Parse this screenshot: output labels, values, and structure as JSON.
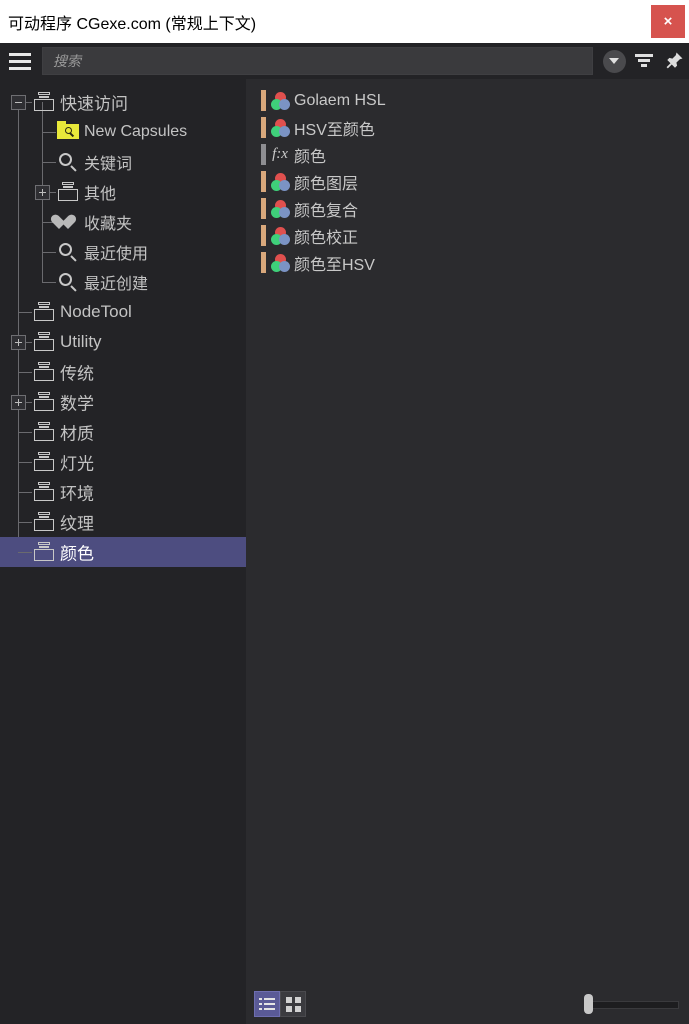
{
  "window": {
    "title": "可动程序 CGexe.com (常规上下文)",
    "close_label": "×",
    "close_icon": "close-icon",
    "close_color": "#d6534e"
  },
  "toolbar": {
    "menu_icon": "hamburger-menu-icon",
    "search_placeholder": "搜索",
    "search_value": "",
    "dropdown_icon": "chevron-down-icon",
    "filter_icon": "filter-icon",
    "pin_icon": "pin-icon"
  },
  "tree": {
    "items": [
      {
        "label": "快速访问",
        "icon": "capsule-icon",
        "indent": 0,
        "toggle": "minus",
        "selected": false
      },
      {
        "label": "New Capsules",
        "icon": "folder-icon",
        "indent": 1,
        "toggle": "none",
        "selected": false
      },
      {
        "label": "关键词",
        "icon": "magnifier-icon",
        "indent": 1,
        "toggle": "none",
        "selected": false
      },
      {
        "label": "其他",
        "icon": "capsule-icon",
        "indent": 1,
        "toggle": "plus",
        "selected": false
      },
      {
        "label": "收藏夹",
        "icon": "heart-icon",
        "indent": 1,
        "toggle": "none",
        "selected": false
      },
      {
        "label": "最近使用",
        "icon": "magnifier-icon",
        "indent": 1,
        "toggle": "none",
        "selected": false
      },
      {
        "label": "最近创建",
        "icon": "magnifier-icon",
        "indent": 1,
        "toggle": "none",
        "selected": false
      },
      {
        "label": "NodeTool",
        "icon": "capsule-icon",
        "indent": 0,
        "toggle": "none",
        "selected": false
      },
      {
        "label": "Utility",
        "icon": "capsule-icon",
        "indent": 0,
        "toggle": "plus",
        "selected": false
      },
      {
        "label": "传统",
        "icon": "capsule-icon",
        "indent": 0,
        "toggle": "none",
        "selected": false
      },
      {
        "label": "数学",
        "icon": "capsule-icon",
        "indent": 0,
        "toggle": "plus",
        "selected": false
      },
      {
        "label": "材质",
        "icon": "capsule-icon",
        "indent": 0,
        "toggle": "none",
        "selected": false
      },
      {
        "label": "灯光",
        "icon": "capsule-icon",
        "indent": 0,
        "toggle": "none",
        "selected": false
      },
      {
        "label": "环境",
        "icon": "capsule-icon",
        "indent": 0,
        "toggle": "none",
        "selected": false
      },
      {
        "label": "纹理",
        "icon": "capsule-icon",
        "indent": 0,
        "toggle": "none",
        "selected": false
      },
      {
        "label": "颜色",
        "icon": "capsule-icon",
        "indent": 0,
        "toggle": "none",
        "selected": true
      }
    ],
    "selected_color": "#4d4d80"
  },
  "list": {
    "items": [
      {
        "label": "Golaem HSL",
        "icon": "rgb-circles-icon",
        "bar_color": "#d9a87c"
      },
      {
        "label": "HSV至颜色",
        "icon": "rgb-circles-icon",
        "bar_color": "#d9a87c"
      },
      {
        "label": "颜色",
        "icon": "fx-icon",
        "bar_color": "#8e8e92",
        "icon_text": "f:x"
      },
      {
        "label": "颜色图层",
        "icon": "rgb-circles-icon",
        "bar_color": "#d9a87c"
      },
      {
        "label": "颜色复合",
        "icon": "rgb-circles-icon",
        "bar_color": "#d9a87c"
      },
      {
        "label": "颜色校正",
        "icon": "rgb-circles-icon",
        "bar_color": "#d9a87c"
      },
      {
        "label": "颜色至HSV",
        "icon": "rgb-circles-icon",
        "bar_color": "#d9a87c"
      }
    ]
  },
  "statusbar": {
    "list_view_icon": "list-view-icon",
    "grid_view_icon": "grid-view-icon",
    "active_view": "list",
    "zoom_slider_value": 0,
    "accent_color": "#5a5a96"
  }
}
